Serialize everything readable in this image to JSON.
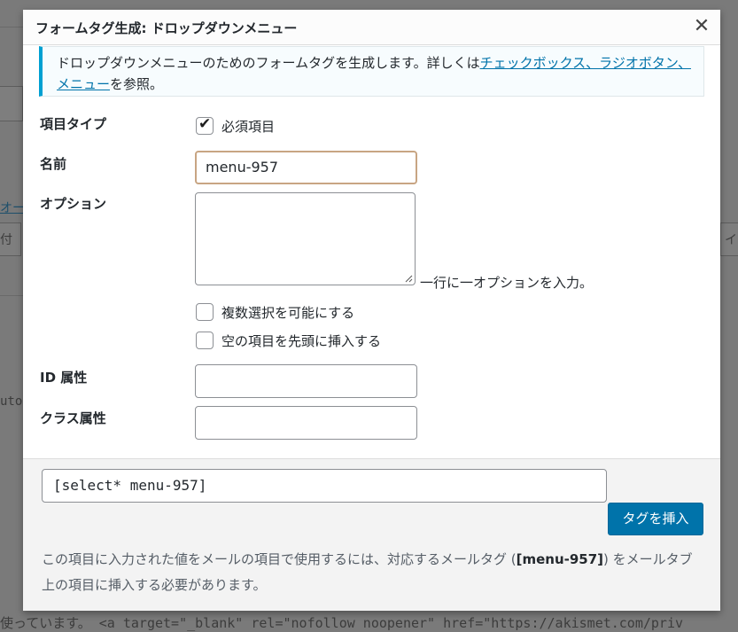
{
  "background": {
    "left_fragments": [
      "オー",
      "付",
      "uto"
    ],
    "right_fragment": "イ",
    "bottom_line": "使っています。 <a target=\"_blank\" rel=\"nofollow noopener\" href=\"https://akismet.com/priv"
  },
  "dialog": {
    "title": "フォームタグ生成: ドロップダウンメニュー",
    "close_icon": "close-icon",
    "notice": {
      "text_before": "ドロップダウンメニューのためのフォームタグを生成します。詳しくは",
      "link_text": "チェックボックス、ラジオボタン、メニュー",
      "text_after": "を参照。"
    },
    "fields": {
      "type_label": "項目タイプ",
      "required_label": "必須項目",
      "required_checked": true,
      "name_label": "名前",
      "name_value": "menu-957",
      "options_label": "オプション",
      "options_value": "",
      "options_hint": "一行に一オプションを入力。",
      "multiple_label": "複数選択を可能にする",
      "multiple_checked": false,
      "blank_label": "空の項目を先頭に挿入する",
      "blank_checked": false,
      "id_label": "ID 属性",
      "id_value": "",
      "class_label": "クラス属性",
      "class_value": ""
    },
    "footer": {
      "tag_value": "[select* menu-957]",
      "insert_button": "タグを挿入",
      "note_before": "この項目に入力された値をメールの項目で使用するには、対応するメールタグ (",
      "note_tag": "[menu-957]",
      "note_after": ") をメールタブ上の項目に挿入する必要があります。"
    }
  }
}
